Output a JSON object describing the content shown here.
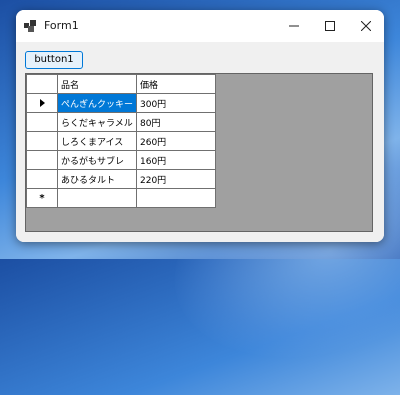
{
  "window": {
    "title": "Form1",
    "icon": "winforms-app-icon",
    "controls": [
      "minimize-icon",
      "maximize-icon",
      "close-icon"
    ]
  },
  "button1": {
    "label": "button1"
  },
  "grid": {
    "columns": [
      "品名",
      "価格"
    ],
    "rows": [
      {
        "name": "ぺんぎんクッキー",
        "price": "300円"
      },
      {
        "name": "らくだキャラメル",
        "price": "80円"
      },
      {
        "name": "しろくまアイス",
        "price": "260円"
      },
      {
        "name": "かるがもサブレ",
        "price": "160円"
      },
      {
        "name": "あひるタルト",
        "price": "220円"
      }
    ],
    "selected_row": 0,
    "new_row_glyph": "*",
    "colors": {
      "selection": "#0078d7",
      "empty_area": "#a0a0a0"
    }
  }
}
